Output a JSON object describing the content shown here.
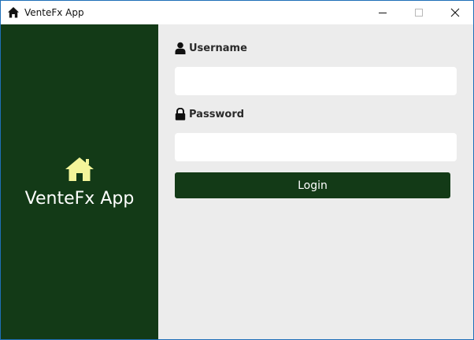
{
  "window": {
    "title": "VenteFx App",
    "app_icon": "home-icon",
    "controls": {
      "minimize_icon": "minimize-icon",
      "maximize_icon": "maximize-icon",
      "close_icon": "close-icon"
    }
  },
  "sidebar": {
    "brand_icon": "home-icon",
    "brand_name": "VenteFx App"
  },
  "form": {
    "username": {
      "icon": "user-icon",
      "label": "Username",
      "value": "",
      "placeholder": ""
    },
    "password": {
      "icon": "lock-icon",
      "label": "Password",
      "value": "",
      "placeholder": ""
    },
    "login_label": "Login"
  },
  "colors": {
    "sidebar_bg": "#133a17",
    "brand_icon": "#f4f59a",
    "button_bg": "#133a17",
    "form_bg": "#ececec"
  }
}
